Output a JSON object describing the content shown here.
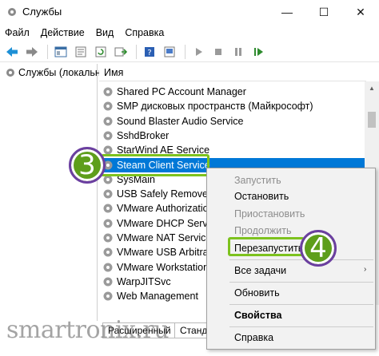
{
  "window": {
    "title": "Службы",
    "minimize_glyph": "—",
    "maximize_glyph": "☐",
    "close_glyph": "✕"
  },
  "menu": [
    "Файл",
    "Действие",
    "Вид",
    "Справка"
  ],
  "toolbar_icons": [
    "back-arrow-icon",
    "forward-arrow-icon",
    "show-pane-icon",
    "properties-icon",
    "refresh-icon",
    "export-list-icon",
    "help-icon",
    "console-icon",
    "play-icon",
    "stop-icon",
    "pause-icon",
    "resume-icon"
  ],
  "tree": {
    "root_label": "Службы (локальн"
  },
  "list": {
    "column_header": "Имя",
    "services": [
      "Shared PC Account Manager",
      "SMP дисковых пространств (Майкрософт)",
      "Sound Blaster Audio Service",
      "SshdBroker",
      "StarWind AE Service",
      "Steam Client Service",
      "SysMain",
      "USB Safely Remove As",
      "VMware Authorization",
      "VMware DHCP Service",
      "VMware NAT Service",
      "VMware USB Arbitratio",
      "VMware Workstation S",
      "WarpJITSvc",
      "Web Management"
    ],
    "selected_index": 5
  },
  "tabs": [
    "Расширенный",
    "Стандартный"
  ],
  "tab_display": [
    "Расширенный",
    "Станда"
  ],
  "context_menu": {
    "start": "Запустить",
    "stop": "Остановить",
    "pause": "Приостановить",
    "resume": "Продолжить",
    "restart": "Перезапустить",
    "all_tasks": "Все задачи",
    "all_tasks_arrow": "›",
    "refresh": "Обновить",
    "properties": "Свойства",
    "help": "Справка"
  },
  "badges": {
    "step_select": "3",
    "step_restart": "4"
  },
  "watermark": "smartronix.ru",
  "colors": {
    "highlight_green": "#7dc21e",
    "badge_green": "#5e9e1b",
    "badge_ring": "#6b3fa0",
    "selection_blue": "#0078d7"
  }
}
